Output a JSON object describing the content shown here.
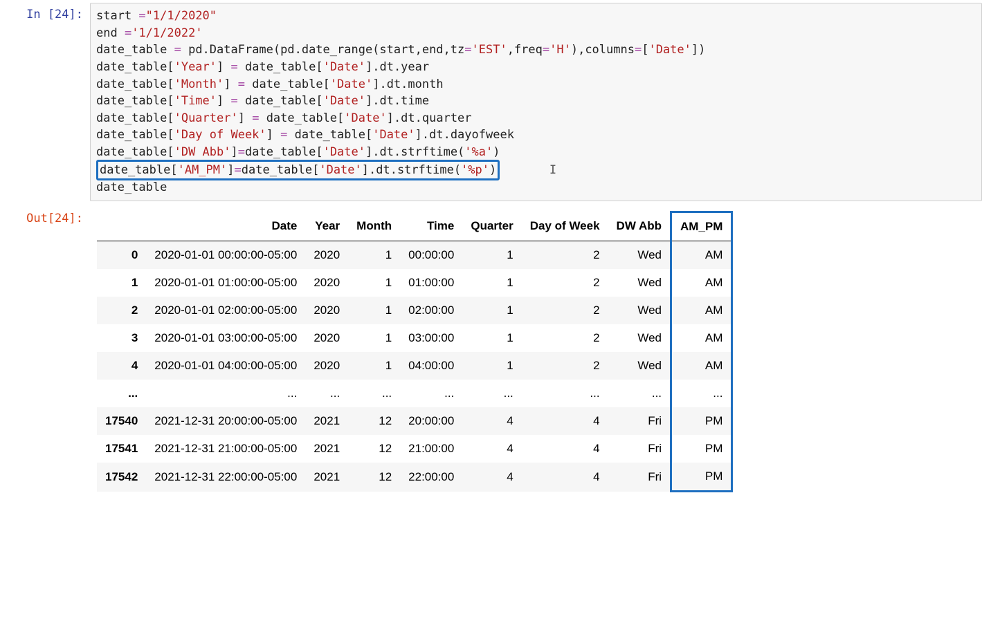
{
  "inPrompt": "In [24]:",
  "outPrompt": "Out[24]:",
  "code": {
    "l1": {
      "a": "start ",
      "op": "=",
      "s": "\"1/1/2020\""
    },
    "l2": {
      "a": "end ",
      "op": "=",
      "s": "'1/1/2022'"
    },
    "l3": {
      "a": "date_table ",
      "op": "= ",
      "b": "pd.DataFrame(pd.date_range(start,end,tz",
      "op2": "=",
      "s1": "'EST'",
      "c": ",freq",
      "op3": "=",
      "s2": "'H'",
      "d": "),columns",
      "op4": "=",
      "e": "[",
      "s3": "'Date'",
      "f": "])"
    },
    "l4": {
      "a": "date_table[",
      "s1": "'Year'",
      "b": "] ",
      "op": "= ",
      "c": "date_table[",
      "s2": "'Date'",
      "d": "].dt.year"
    },
    "l5": {
      "a": "date_table[",
      "s1": "'Month'",
      "b": "] ",
      "op": "= ",
      "c": "date_table[",
      "s2": "'Date'",
      "d": "].dt.month"
    },
    "l6": {
      "a": "date_table[",
      "s1": "'Time'",
      "b": "] ",
      "op": "= ",
      "c": "date_table[",
      "s2": "'Date'",
      "d": "].dt.time"
    },
    "l7": {
      "a": "date_table[",
      "s1": "'Quarter'",
      "b": "] ",
      "op": "= ",
      "c": "date_table[",
      "s2": "'Date'",
      "d": "].dt.quarter"
    },
    "l8": {
      "a": "date_table[",
      "s1": "'Day of Week'",
      "b": "] ",
      "op": "= ",
      "c": "date_table[",
      "s2": "'Date'",
      "d": "].dt.dayofweek"
    },
    "l9": {
      "a": "date_table[",
      "s1": "'DW Abb'",
      "b": "]",
      "op": "=",
      "c": "date_table[",
      "s2": "'Date'",
      "d": "].dt.strftime(",
      "s3": "'%a'",
      "e": ")"
    },
    "l10": {
      "a": "date_table[",
      "s1": "'AM_PM'",
      "b": "]",
      "op": "=",
      "c": "date_table[",
      "s2": "'Date'",
      "d": "].dt.strftime(",
      "s3": "'%p'",
      "e": ")"
    },
    "l11": {
      "a": "date_table"
    }
  },
  "table": {
    "headers": [
      "Date",
      "Year",
      "Month",
      "Time",
      "Quarter",
      "Day of Week",
      "DW Abb",
      "AM_PM"
    ],
    "rows": [
      {
        "idx": "0",
        "Date": "2020-01-01 00:00:00-05:00",
        "Year": "2020",
        "Month": "1",
        "Time": "00:00:00",
        "Quarter": "1",
        "DayOfWeek": "2",
        "DWAbb": "Wed",
        "AM_PM": "AM"
      },
      {
        "idx": "1",
        "Date": "2020-01-01 01:00:00-05:00",
        "Year": "2020",
        "Month": "1",
        "Time": "01:00:00",
        "Quarter": "1",
        "DayOfWeek": "2",
        "DWAbb": "Wed",
        "AM_PM": "AM"
      },
      {
        "idx": "2",
        "Date": "2020-01-01 02:00:00-05:00",
        "Year": "2020",
        "Month": "1",
        "Time": "02:00:00",
        "Quarter": "1",
        "DayOfWeek": "2",
        "DWAbb": "Wed",
        "AM_PM": "AM"
      },
      {
        "idx": "3",
        "Date": "2020-01-01 03:00:00-05:00",
        "Year": "2020",
        "Month": "1",
        "Time": "03:00:00",
        "Quarter": "1",
        "DayOfWeek": "2",
        "DWAbb": "Wed",
        "AM_PM": "AM"
      },
      {
        "idx": "4",
        "Date": "2020-01-01 04:00:00-05:00",
        "Year": "2020",
        "Month": "1",
        "Time": "04:00:00",
        "Quarter": "1",
        "DayOfWeek": "2",
        "DWAbb": "Wed",
        "AM_PM": "AM"
      },
      {
        "idx": "...",
        "Date": "...",
        "Year": "...",
        "Month": "...",
        "Time": "...",
        "Quarter": "...",
        "DayOfWeek": "...",
        "DWAbb": "...",
        "AM_PM": "..."
      },
      {
        "idx": "17540",
        "Date": "2021-12-31 20:00:00-05:00",
        "Year": "2021",
        "Month": "12",
        "Time": "20:00:00",
        "Quarter": "4",
        "DayOfWeek": "4",
        "DWAbb": "Fri",
        "AM_PM": "PM"
      },
      {
        "idx": "17541",
        "Date": "2021-12-31 21:00:00-05:00",
        "Year": "2021",
        "Month": "12",
        "Time": "21:00:00",
        "Quarter": "4",
        "DayOfWeek": "4",
        "DWAbb": "Fri",
        "AM_PM": "PM"
      },
      {
        "idx": "17542",
        "Date": "2021-12-31 22:00:00-05:00",
        "Year": "2021",
        "Month": "12",
        "Time": "22:00:00",
        "Quarter": "4",
        "DayOfWeek": "4",
        "DWAbb": "Fri",
        "AM_PM": "PM"
      }
    ]
  },
  "cursor": "I"
}
